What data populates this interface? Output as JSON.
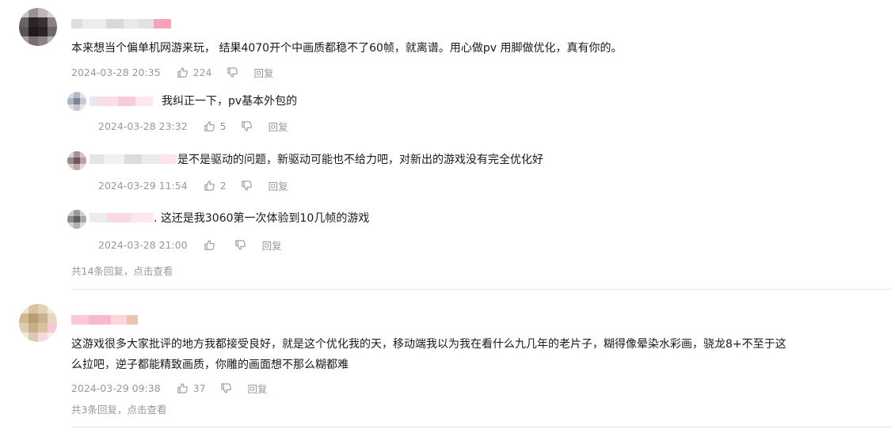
{
  "comments": [
    {
      "text": "本来想当个偏单机网游来玩， 结果4070开个中画质都稳不了60帧，就离谱。用心做pv 用脚做优化，真有你的。",
      "time": "2024-03-28 20:35",
      "likes": "224",
      "reply_label": "回复",
      "replies": [
        {
          "text": "我纠正一下，pv基本外包的",
          "time": "2024-03-28 23:32",
          "likes": "5",
          "reply_label": "回复"
        },
        {
          "text": "是不是驱动的问题，新驱动可能也不给力吧，对新出的游戏没有完全优化好",
          "time": "2024-03-29 11:54",
          "likes": "2",
          "reply_label": "回复"
        },
        {
          "text": ". 这还是我3060第一次体验到10几帧的游戏",
          "time": "2024-03-28 21:00",
          "likes": "",
          "reply_label": "回复"
        }
      ],
      "view_more": "共14条回复，点击查看"
    },
    {
      "text_line1": "这游戏很多大家批评的地方我都接受良好，就是这个优化我的天，移动端我以为我在看什么九几年的老片子，糊得像晕染水彩画，骁龙8+不至于这",
      "text_line2": "么拉吧，逆子都能精致画质，你雕的画面想不那么糊都难",
      "time": "2024-03-29 09:38",
      "likes": "37",
      "reply_label": "回复",
      "view_more": "共3条回复，点击查看"
    }
  ],
  "colors": {
    "text": "#18191c",
    "meta": "#9499a0",
    "divider": "#e3e5e7",
    "name_pink": "#f7a3b7"
  },
  "icons": {
    "like": "thumbs-up-icon",
    "dislike": "thumbs-down-icon"
  }
}
